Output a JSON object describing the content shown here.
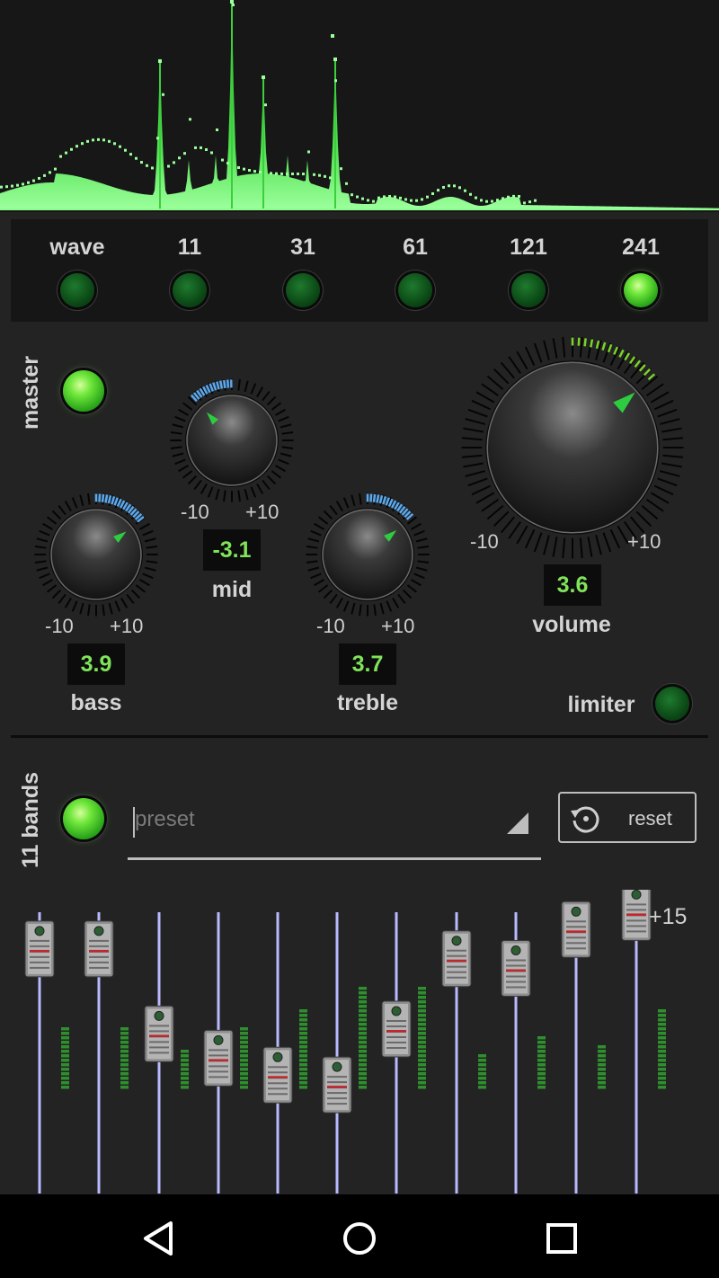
{
  "colors": {
    "accent_green": "#7fe45a",
    "spectrum_green": "#3fd13f",
    "led_on": "#6ee63a",
    "led_off": "#0d4d18",
    "tick_blue": "#5aa9f0",
    "tick_green": "#7bd32a",
    "fader_track": "#b9b9ff"
  },
  "spectrum_modes": [
    {
      "label": "wave",
      "on": false
    },
    {
      "label": "11",
      "on": false
    },
    {
      "label": "31",
      "on": false
    },
    {
      "label": "61",
      "on": false
    },
    {
      "label": "121",
      "on": false
    },
    {
      "label": "241",
      "on": true
    }
  ],
  "master": {
    "label": "master",
    "on": true
  },
  "knobs": {
    "bass": {
      "label": "bass",
      "value": "3.9",
      "min": "-10",
      "max": "+10"
    },
    "mid": {
      "label": "mid",
      "value": "-3.1",
      "min": "-10",
      "max": "+10"
    },
    "treble": {
      "label": "treble",
      "value": "3.7",
      "min": "-10",
      "max": "+10"
    },
    "volume": {
      "label": "volume",
      "value": "3.6",
      "min": "-10",
      "max": "+10"
    }
  },
  "limiter": {
    "label": "limiter",
    "on": false
  },
  "bands": {
    "label": "11 bands",
    "on": true
  },
  "preset": {
    "placeholder": "preset",
    "value": ""
  },
  "reset": {
    "label": "reset",
    "icon": "reset-icon"
  },
  "eq": {
    "max_label": "+15",
    "band_count": 11,
    "levels": [
      0.43,
      0.43,
      0.08,
      -0.02,
      -0.09,
      -0.13,
      0.1,
      0.39,
      0.35,
      0.51,
      0.58
    ],
    "meters": [
      0.23,
      0.23,
      0.15,
      0.23,
      0.3,
      0.37,
      0.37,
      0.12,
      0.19,
      0.16,
      0.29
    ]
  },
  "navbar": {
    "back_icon": "back-icon",
    "home_icon": "home-icon",
    "recents_icon": "recents-icon"
  }
}
